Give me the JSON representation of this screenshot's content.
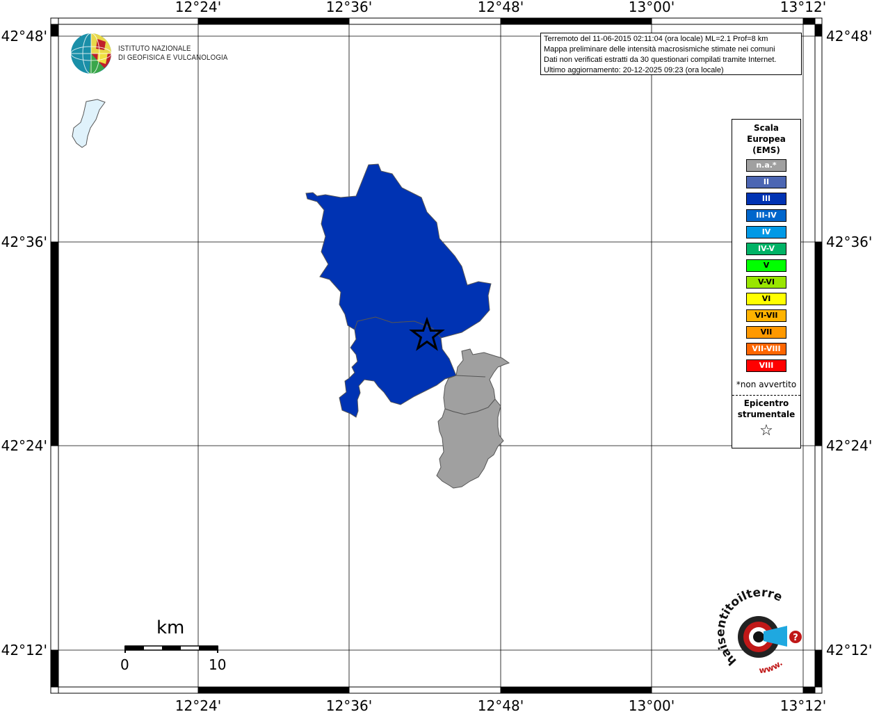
{
  "header": {
    "logo_line1": "ISTITUTO NAZIONALE",
    "logo_line2": "DI GEOFISICA E VULCANOLOGIA"
  },
  "info": {
    "line1": "Terremoto del 11-06-2015 02:11:04 (ora locale) ML=2.1 Prof=8 km",
    "line2": "Mappa preliminare delle intensità macrosismiche stimate nei comuni",
    "line3": "Dati non verificati estratti da 30 questionari compilati tramite Internet.",
    "line4": "Ultimo aggiornamento: 20-12-2025 09:23 (ora locale)"
  },
  "axes": {
    "lon_labels": [
      "12°24'",
      "12°36'",
      "12°48'",
      "13°00'",
      "13°12'"
    ],
    "lat_labels": [
      "42°48'",
      "42°36'",
      "42°24'",
      "42°12'"
    ]
  },
  "legend": {
    "title1": "Scala",
    "title2": "Europea",
    "title3": "(EMS)",
    "items": [
      {
        "label": "n.a.*",
        "color": "#a0a0a0"
      },
      {
        "label": "II",
        "color": "#4c66b3"
      },
      {
        "label": "III",
        "color": "#0033b3"
      },
      {
        "label": "III-IV",
        "color": "#0066cc"
      },
      {
        "label": "IV",
        "color": "#0099e6"
      },
      {
        "label": "IV-V",
        "color": "#00b366"
      },
      {
        "label": "V",
        "color": "#00ff00"
      },
      {
        "label": "V-VI",
        "color": "#99e600"
      },
      {
        "label": "VI",
        "color": "#ffff00"
      },
      {
        "label": "VI-VII",
        "color": "#ffb300"
      },
      {
        "label": "VII",
        "color": "#ff9900"
      },
      {
        "label": "VII-VIII",
        "color": "#ff6600"
      },
      {
        "label": "VIII",
        "color": "#ff0000"
      }
    ],
    "note": "*non avvertito",
    "epicenter1": "Epicentro",
    "epicenter2": "strumentale",
    "epicenter_symbol": "☆"
  },
  "scalebar": {
    "unit": "km",
    "start": "0",
    "end": "10"
  },
  "watermark": {
    "text": "haisentitoilterremoto.it",
    "url": "www.",
    "question": "?"
  },
  "colors": {
    "intensity_III": "#0033b3",
    "not_available": "#a0a0a0",
    "lake": "#e0f2fb"
  }
}
